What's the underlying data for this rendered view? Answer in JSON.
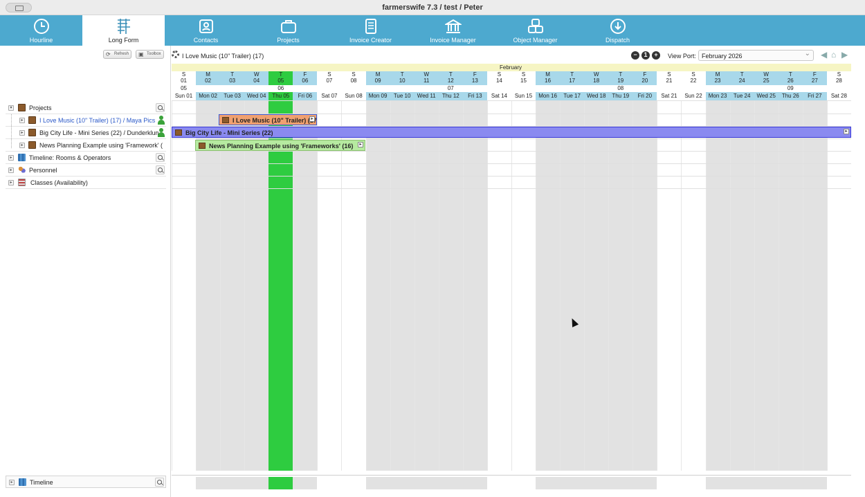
{
  "window": {
    "title": "farmerswife 7.3  / test / Peter"
  },
  "nav": [
    {
      "label": "Hourline",
      "icon": "clock-icon",
      "active": false
    },
    {
      "label": "Long Form",
      "icon": "longform-icon",
      "active": true
    },
    {
      "label": "Contacts",
      "icon": "contacts-icon",
      "active": false
    },
    {
      "label": "Projects",
      "icon": "briefcase-icon",
      "active": false
    },
    {
      "label": "Invoice Creator",
      "icon": "document-icon",
      "active": false
    },
    {
      "label": "Invoice Manager",
      "icon": "bank-icon",
      "active": false
    },
    {
      "label": "Object Manager",
      "icon": "cubes-icon",
      "active": false
    },
    {
      "label": "Dispatch",
      "icon": "dispatch-icon",
      "active": false
    }
  ],
  "toolbar": {
    "refresh": "Refresh",
    "toolbox": "Toolbox"
  },
  "tree": {
    "projects": "Projects",
    "items": [
      "I Love Music (10\" Trailer) (17) / Maya Pics",
      "Big City Life - Mini Series (22) / Dunderklum",
      "News Planning Example using 'Framework' (",
      "Timeline: Rooms & Operators",
      "Personnel",
      "Classes (Availability)"
    ],
    "bottom": "Timeline"
  },
  "header": {
    "current_project": "I Love Music (10\" Trailer) (17)",
    "zoom_out": "−",
    "zoom_reset": "1",
    "zoom_in": "+",
    "viewport_label": "View Port:",
    "viewport_value": "February 2026"
  },
  "calendar": {
    "month": "February",
    "letters": [
      "S",
      "M",
      "T",
      "W",
      "T",
      "F",
      "S",
      "S",
      "M",
      "T",
      "W",
      "T",
      "F",
      "S",
      "S",
      "M",
      "T",
      "W",
      "T",
      "F",
      "S",
      "S",
      "M",
      "T",
      "W",
      "T",
      "F",
      "S"
    ],
    "numbers": [
      "01",
      "02",
      "03",
      "04",
      "05",
      "06",
      "07",
      "08",
      "09",
      "10",
      "11",
      "12",
      "13",
      "14",
      "15",
      "16",
      "17",
      "18",
      "19",
      "20",
      "21",
      "22",
      "23",
      "24",
      "25",
      "26",
      "27",
      "28"
    ],
    "weeks": [
      "05",
      "06",
      "07",
      "08",
      "09"
    ],
    "day_labels": [
      "Sun 01",
      "Mon 02",
      "Tue 03",
      "Wed 04",
      "Thu 05",
      "Fri 06",
      "Sat 07",
      "Sun 08",
      "Mon 09",
      "Tue 10",
      "Wed 11",
      "Thu 12",
      "Fri 13",
      "Sat 14",
      "Sun 15",
      "Mon 16",
      "Tue 17",
      "Wed 18",
      "Thu 19",
      "Fri 20",
      "Sat 21",
      "Sun 22",
      "Mon 23",
      "Tue 24",
      "Wed 25",
      "Thu 26",
      "Fri 27",
      "Sat 28"
    ],
    "today_index": 4
  },
  "bookings": [
    {
      "label": "I Love Music (10\" Trailer) (17)",
      "start": 2,
      "end": 6,
      "color": "#f0a070"
    },
    {
      "label": "Big City Life - Mini Series (22)",
      "start": 0,
      "end": 28,
      "color": "#8a8af0"
    },
    {
      "label": "News Planning Example using 'Frameworks' (16)",
      "start": 1,
      "end": 8,
      "color": "#b6eaa0"
    }
  ],
  "colors": {
    "nav": "#4da9cf",
    "today": "#2ecc40",
    "weekend": "#ffffff",
    "weekday": "#e2e2e2",
    "week_header": "#a8d8ea"
  }
}
